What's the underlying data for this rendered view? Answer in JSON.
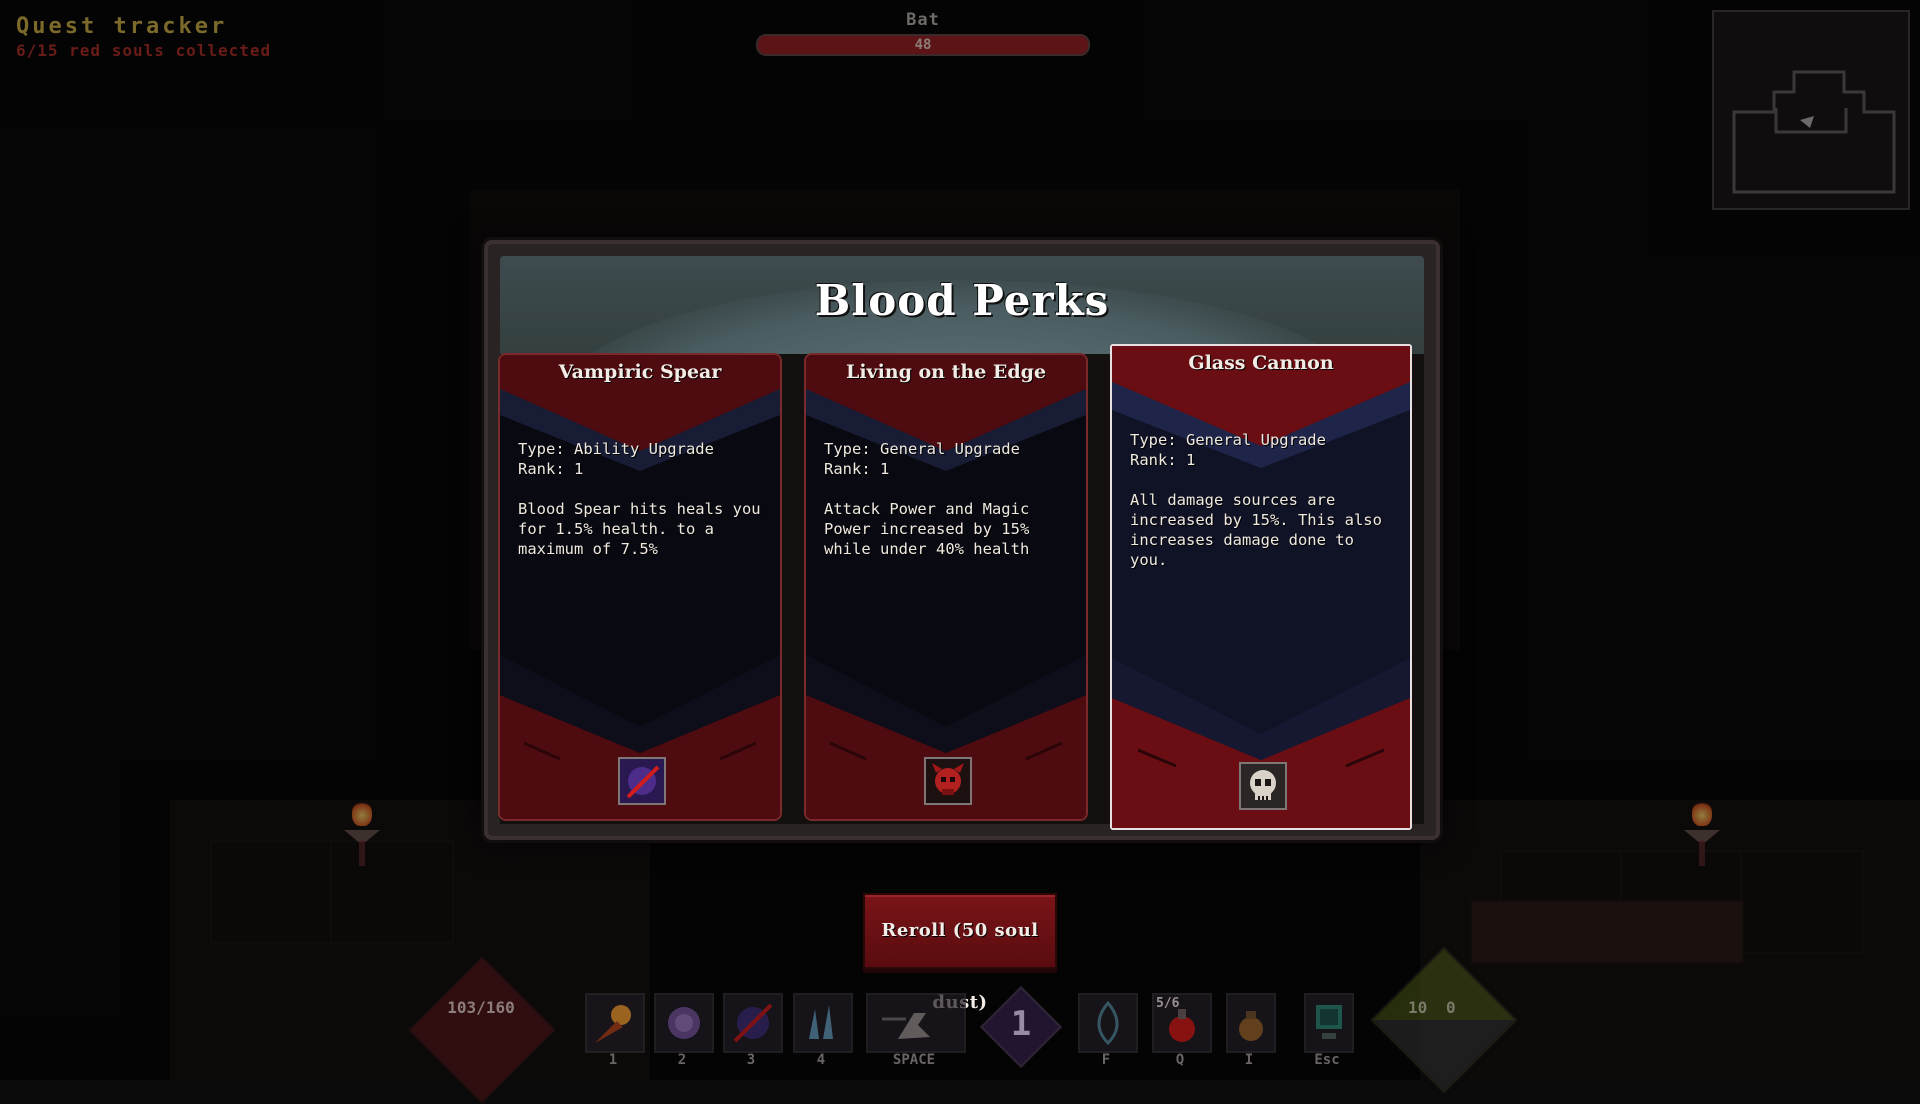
{
  "quest": {
    "title": "Quest tracker",
    "progress": "6/15 red souls collected"
  },
  "enemy": {
    "name": "Bat",
    "hp_text": "48",
    "hp_fraction": 1.0
  },
  "modal": {
    "title": "Blood Perks",
    "reroll_label": "Reroll (50 soul dust)"
  },
  "cards": [
    {
      "name": "Vampiric Spear",
      "type": "Type: Ability Upgrade",
      "rank": "Rank: 1",
      "desc": "Blood Spear hits heals you for 1.5% health. to a maximum of 7.5%",
      "icon": "blood-spear-icon",
      "selected": false
    },
    {
      "name": "Living on the Edge",
      "type": "Type: General Upgrade",
      "rank": "Rank: 1",
      "desc": "Attack Power and Magic Power increased by 15% while under 40% health",
      "icon": "demon-skull-icon",
      "selected": false
    },
    {
      "name": "Glass Cannon",
      "type": "Type: General Upgrade",
      "rank": "Rank: 1",
      "desc": "All damage sources are increased by 15%. This also increases damage done to you.",
      "icon": "skull-icon",
      "selected": true
    }
  ],
  "hud": {
    "health": "103/160",
    "level": "1",
    "potions": "5/6",
    "gold_left": "10",
    "gold_right": "0",
    "hotbar": [
      {
        "key": "1",
        "icon": "fireball-icon"
      },
      {
        "key": "2",
        "icon": "spiked-orb-icon"
      },
      {
        "key": "3",
        "icon": "blood-spear-icon"
      },
      {
        "key": "4",
        "icon": "ice-shards-icon"
      },
      {
        "key": "SPACE",
        "icon": "dash-icon"
      },
      {
        "key": "F",
        "icon": "leaf-icon"
      },
      {
        "key": "Q",
        "icon": "health-potion-icon"
      },
      {
        "key": "I",
        "icon": "bag-icon"
      },
      {
        "key": "Esc",
        "icon": "computer-icon"
      }
    ]
  },
  "colors": {
    "card_red": "#5a0c12",
    "card_navy": "#161a33",
    "modal_frame": "#2a2323",
    "header_teal": "#4a5c60"
  }
}
